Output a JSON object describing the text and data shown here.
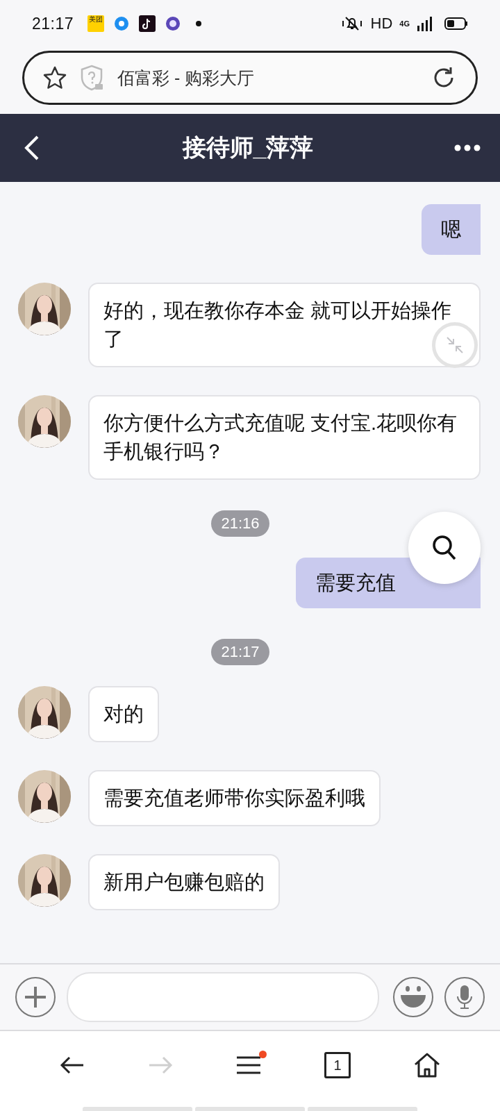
{
  "status_bar": {
    "time": "21:17",
    "app_badge": "美团",
    "network": "HD",
    "signal_label": "4G"
  },
  "address_bar": {
    "title": "佰富彩 - 购彩大厅"
  },
  "chat_header": {
    "title": "接待师_萍萍"
  },
  "messages": [
    {
      "kind": "outgoing",
      "text": "嗯",
      "covered": false
    },
    {
      "kind": "incoming",
      "text": "好的，现在教你存本金 就可以开始操作了"
    },
    {
      "kind": "incoming",
      "text": "你方便什么方式充值呢 支付宝.花呗你有手机银行吗？"
    },
    {
      "kind": "time",
      "text": "21:16"
    },
    {
      "kind": "outgoing",
      "text": "需要充值",
      "covered": true
    },
    {
      "kind": "time",
      "text": "21:17"
    },
    {
      "kind": "incoming",
      "text": "对的"
    },
    {
      "kind": "incoming",
      "text": "需要充值老师带你实际盈利哦"
    },
    {
      "kind": "incoming",
      "text": "新用户包赚包赔的"
    }
  ],
  "bottom_nav": [
    {
      "kind": "back",
      "disabled": false
    },
    {
      "kind": "forward",
      "disabled": true
    },
    {
      "kind": "menu",
      "notification": true
    },
    {
      "kind": "tabs",
      "count": "1"
    },
    {
      "kind": "home"
    }
  ]
}
